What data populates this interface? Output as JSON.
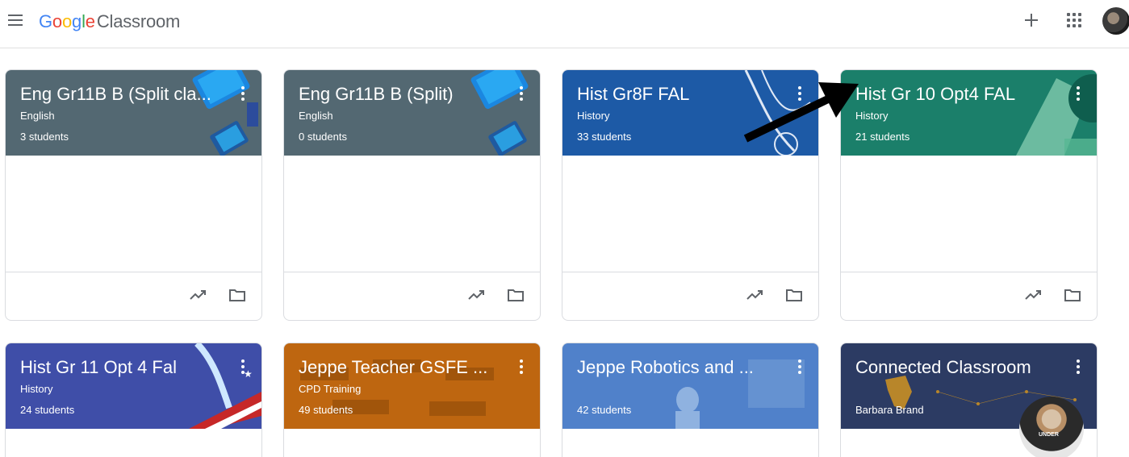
{
  "app": {
    "logo_google": [
      "G",
      "o",
      "o",
      "g",
      "l",
      "e"
    ],
    "product": "Classroom"
  },
  "icons": {
    "menu": "hamburger-menu-icon",
    "create": "plus-icon",
    "apps": "google-apps-grid-icon",
    "account": "profile-avatar"
  },
  "colors": {
    "slate": "#536872",
    "blue": "#1d5aa6",
    "teal": "#1b7f6a",
    "indigo": "#3f4ea8",
    "orange": "#c16a12",
    "steel": "#4a7cc6",
    "navy": "#2c3b63"
  },
  "classes": [
    {
      "title": "Eng Gr11B B (Split cla...",
      "subject": "English",
      "count": "3 students",
      "color": "#536872"
    },
    {
      "title": "Eng Gr11B B (Split)",
      "subject": "English",
      "count": "0 students",
      "color": "#536872"
    },
    {
      "title": "Hist Gr8F FAL",
      "subject": "History",
      "count": "33 students",
      "color": "#1d5aa6"
    },
    {
      "title": "Hist Gr 10 Opt4 FAL",
      "subject": "History",
      "count": "21 students",
      "color": "#1b7f6a"
    },
    {
      "title": "Hist Gr 11 Opt 4 Fal",
      "subject": "History",
      "count": "24 students",
      "color": "#3f4ea8"
    },
    {
      "title": "Jeppe Teacher GSFE ...",
      "subject": "CPD Training",
      "count": "49 students",
      "color": "#c16a12"
    },
    {
      "title": "Jeppe Robotics and ...",
      "subject": "",
      "count": "42 students",
      "color": "#4a7cc6"
    },
    {
      "title": "Connected Classroom",
      "subject": "",
      "count": "Barbara Brand",
      "color": "#2c3b63"
    }
  ],
  "video_overlay_text": "UNDER"
}
